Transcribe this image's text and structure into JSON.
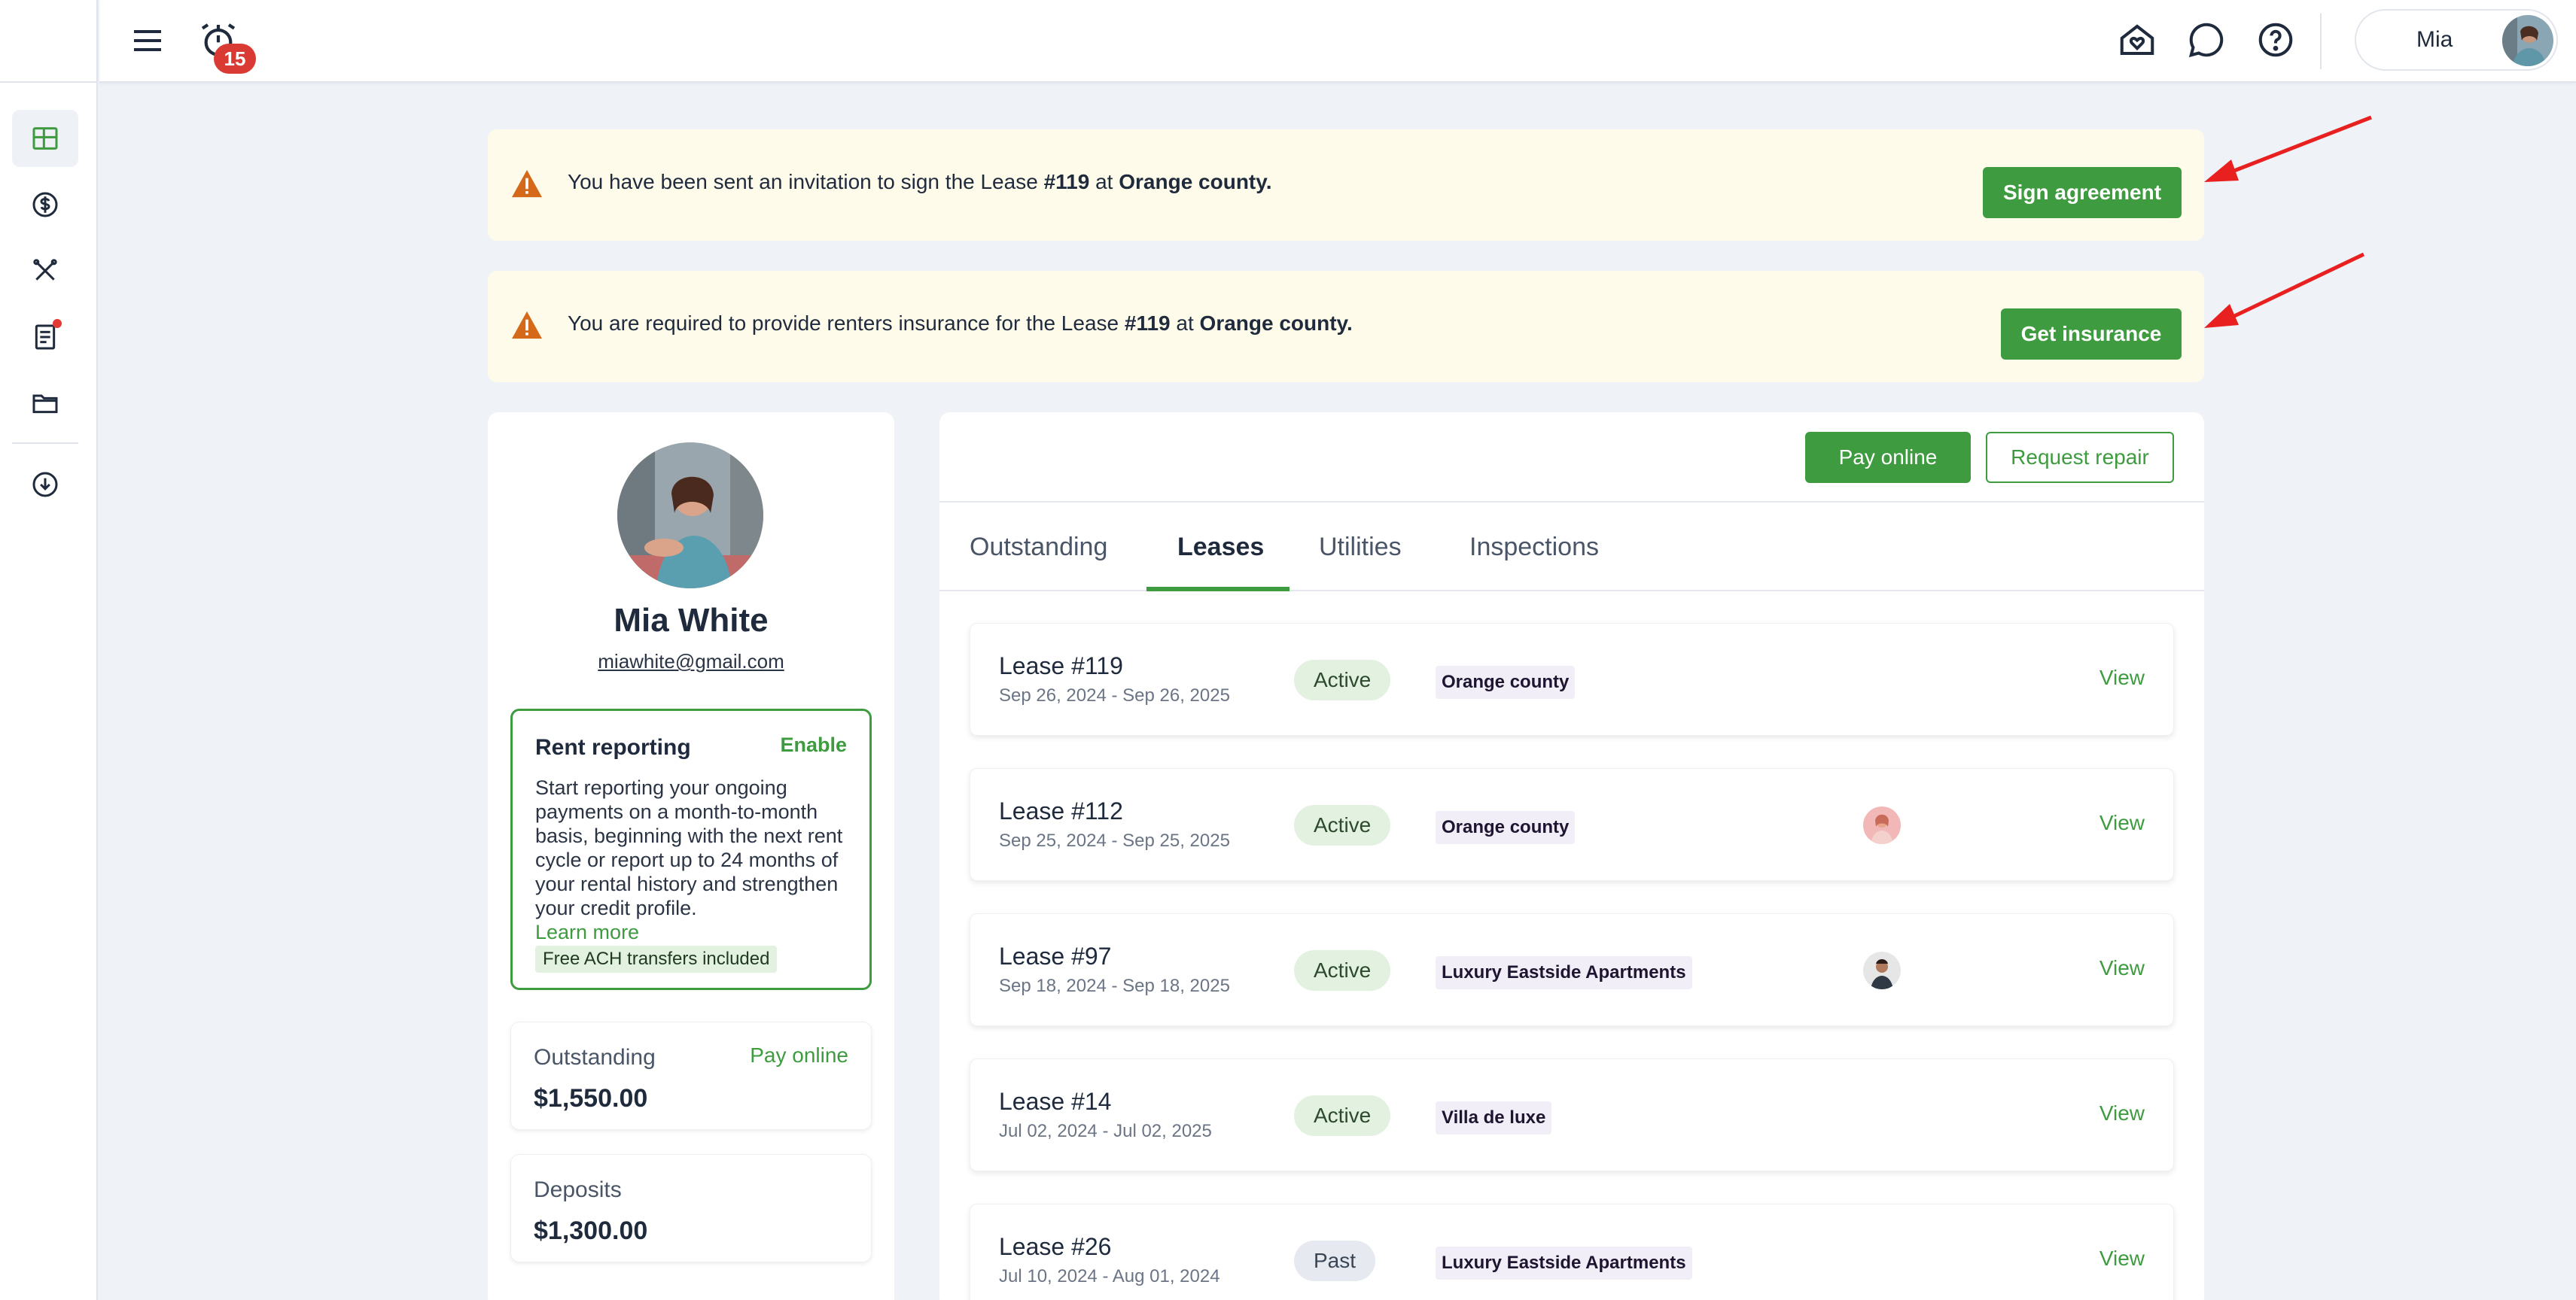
{
  "topbar": {
    "notification_count": "15",
    "user_name": "Mia"
  },
  "alerts": [
    {
      "text_pre": "You have been sent an invitation to sign the Lease ",
      "lease": "#119",
      "text_mid": " at ",
      "property": "Orange county.",
      "button": "Sign agreement"
    },
    {
      "text_pre": "You are required to provide renters insurance for the Lease ",
      "lease": "#119",
      "text_mid": " at ",
      "property": "Orange county.",
      "button": "Get insurance"
    }
  ],
  "profile": {
    "name": "Mia White",
    "email": "miawhite@gmail.com",
    "rent_reporting": {
      "title": "Rent reporting",
      "action": "Enable",
      "description": "Start reporting your ongoing payments on a month-to-month basis, beginning with the next rent cycle or report up to 24 months of your rental history and strengthen your credit profile.",
      "learn_more": "Learn more",
      "tag": "Free ACH transfers included"
    },
    "outstanding": {
      "label": "Outstanding",
      "action": "Pay online",
      "value": "$1,550.00"
    },
    "deposits": {
      "label": "Deposits",
      "value": "$1,300.00"
    }
  },
  "main": {
    "pay_online": "Pay online",
    "request_repair": "Request repair",
    "tabs": [
      "Outstanding",
      "Leases",
      "Utilities",
      "Inspections"
    ],
    "active_tab": "Leases",
    "leases": [
      {
        "name": "Lease #119",
        "dates": "Sep 26, 2024 - Sep 26, 2025",
        "status": "Active",
        "property": "Orange county",
        "view": "View"
      },
      {
        "name": "Lease #112",
        "dates": "Sep 25, 2024 - Sep 25, 2025",
        "status": "Active",
        "property": "Orange county",
        "view": "View"
      },
      {
        "name": "Lease #97",
        "dates": "Sep 18, 2024 - Sep 18, 2025",
        "status": "Active",
        "property": "Luxury Eastside Apartments",
        "view": "View"
      },
      {
        "name": "Lease #14",
        "dates": "Jul 02, 2024 - Jul 02, 2025",
        "status": "Active",
        "property": "Villa de luxe",
        "view": "View"
      },
      {
        "name": "Lease #26",
        "dates": "Jul 10, 2024 - Aug 01, 2024",
        "status": "Past",
        "property": "Luxury Eastside Apartments",
        "view": "View"
      }
    ]
  },
  "colors": {
    "accent": "#3e9b3f",
    "alert_bg": "#fefbea",
    "warning": "#d4691a",
    "badge": "#d93a33",
    "arrow": "#e8201f"
  }
}
